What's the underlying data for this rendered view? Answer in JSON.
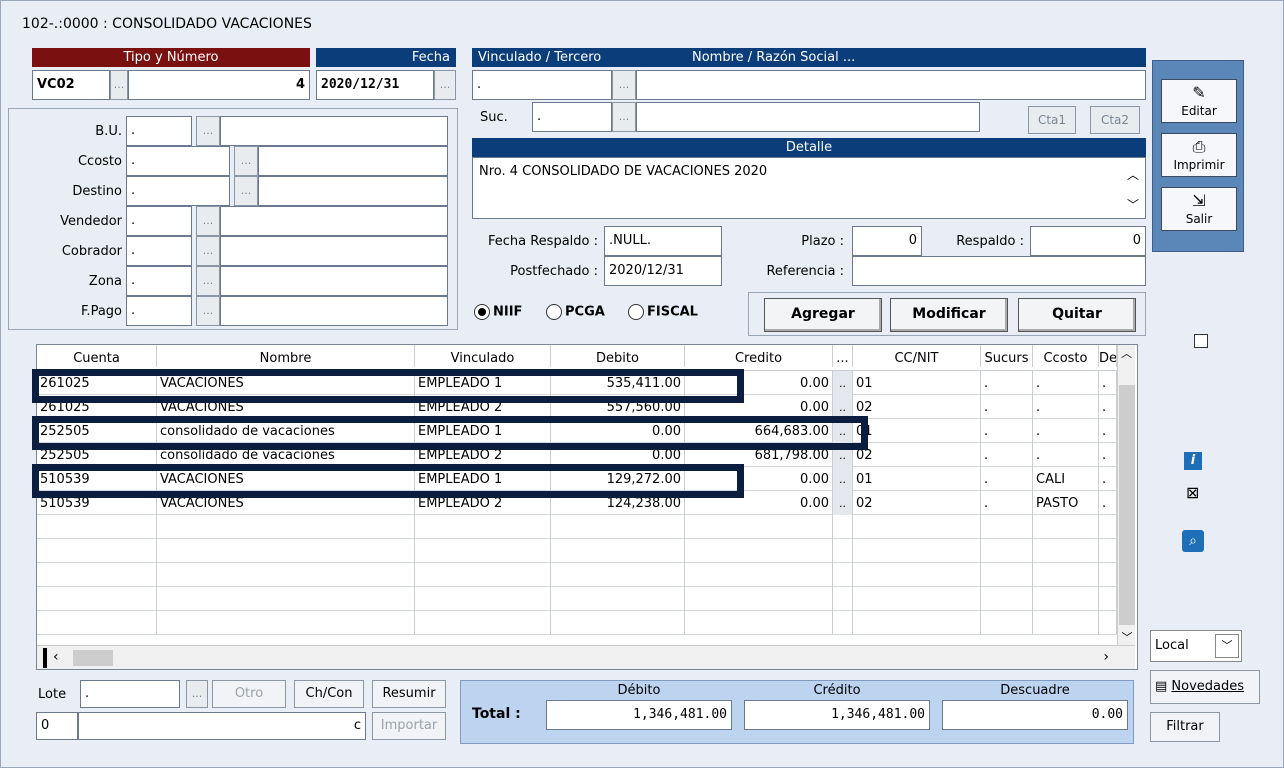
{
  "window": {
    "title": "102-.:0000 : CONSOLIDADO VACACIONES"
  },
  "doc": {
    "tipo_header": "Tipo y Número",
    "fecha_header": "Fecha",
    "tipo": "VC02",
    "numero": "4",
    "fecha": "2020/12/31",
    "vinculado_header": "Vinculado / Tercero",
    "nombre_header": "Nombre / Razón Social ...",
    "vinculado_value": ".",
    "suc_label": "Suc.",
    "suc_value": ".",
    "cta1": "Cta1",
    "cta2": "Cta2",
    "detalle_header": "Detalle",
    "detalle": "Nro. 4 CONSOLIDADO DE VACACIONES 2020",
    "ellipsis": "..."
  },
  "left_fields": [
    {
      "label": "B.U.",
      "value": "."
    },
    {
      "label": "Ccosto",
      "value": "."
    },
    {
      "label": "Destino",
      "value": "."
    },
    {
      "label": "Vendedor",
      "value": "."
    },
    {
      "label": "Cobrador",
      "value": "."
    },
    {
      "label": "Zona",
      "value": "."
    },
    {
      "label": "F.Pago",
      "value": "."
    }
  ],
  "dates": {
    "fecha_respaldo_label": "Fecha Respaldo :",
    "fecha_respaldo": ".NULL.",
    "postfechado_label": "Postfechado :",
    "postfechado": "2020/12/31",
    "plazo_label": "Plazo :",
    "plazo": "0",
    "respaldo_label": "Respaldo :",
    "respaldo": "0",
    "referencia_label": "Referencia :",
    "referencia": ""
  },
  "radios": {
    "niif": "NIIF",
    "pcga": "PCGA",
    "fiscal": "FISCAL"
  },
  "actions": {
    "agregar": "Agregar",
    "modificar": "Modificar",
    "quitar": "Quitar"
  },
  "grid": {
    "columns": {
      "cuenta": "Cuenta",
      "nombre": "Nombre",
      "vinculado": "Vinculado",
      "debito": "Debito",
      "credito": "Credito",
      "dots": "...",
      "ccnit": "CC/NIT",
      "sucurs": "Sucurs",
      "ccosto": "Ccosto",
      "de": "De"
    },
    "rows": [
      {
        "cuenta": "261025",
        "nombre": "VACACIONES",
        "vinculado": "EMPLEADO 1",
        "debito": "535,411.00",
        "credito": "0.00",
        "ccnit": "01",
        "sucurs": ".",
        "ccosto": ".",
        "de": "."
      },
      {
        "cuenta": "261025",
        "nombre": "VACACIONES",
        "vinculado": "EMPLEADO 2",
        "debito": "557,560.00",
        "credito": "0.00",
        "ccnit": "02",
        "sucurs": ".",
        "ccosto": ".",
        "de": "."
      },
      {
        "cuenta": "252505",
        "nombre": "consolidado de vacaciones",
        "vinculado": "EMPLEADO 1",
        "debito": "0.00",
        "credito": "664,683.00",
        "ccnit": "01",
        "sucurs": ".",
        "ccosto": ".",
        "de": "."
      },
      {
        "cuenta": "252505",
        "nombre": "consolidado de vacaciones",
        "vinculado": "EMPLEADO 2",
        "debito": "0.00",
        "credito": "681,798.00",
        "ccnit": "02",
        "sucurs": ".",
        "ccosto": ".",
        "de": "."
      },
      {
        "cuenta": "510539",
        "nombre": "VACACIONES",
        "vinculado": "EMPLEADO 1",
        "debito": "129,272.00",
        "credito": "0.00",
        "ccnit": "01",
        "sucurs": ".",
        "ccosto": "CALI",
        "de": "."
      },
      {
        "cuenta": "510539",
        "nombre": "VACACIONES",
        "vinculado": "EMPLEADO 2",
        "debito": "124,238.00",
        "credito": "0.00",
        "ccnit": "02",
        "sucurs": ".",
        "ccosto": "PASTO",
        "de": "."
      }
    ]
  },
  "bottom": {
    "lote_label": "Lote",
    "lote_value": ".",
    "otro": "Otro",
    "chcon": "Ch/Con",
    "resumir": "Resumir",
    "importar": "Importar",
    "num_value": "0",
    "c_value": "c"
  },
  "totals": {
    "label": "Total :",
    "debito_header": "Débito",
    "credito_header": "Crédito",
    "descuadre_header": "Descuadre",
    "debito": "1,346,481.00",
    "credito": "1,346,481.00",
    "descuadre": "0.00"
  },
  "toolbar": {
    "editar": "Editar",
    "imprimir": "Imprimir",
    "salir": "Salir"
  },
  "side": {
    "local": "Local",
    "novedades": "Novedades",
    "filtrar": "Filtrar"
  }
}
